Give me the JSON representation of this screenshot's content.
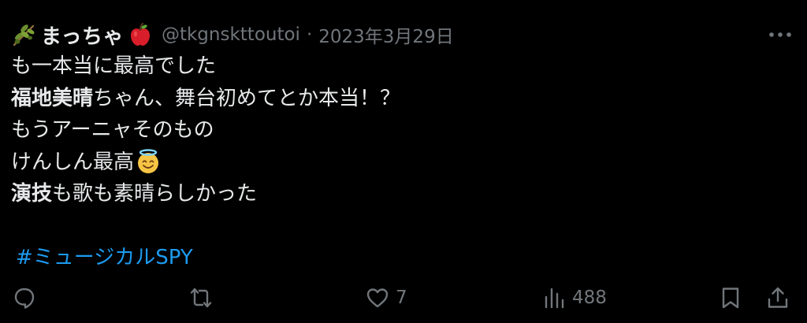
{
  "author": {
    "display_name": "まっちゃ",
    "handle": "@tkgnskttoutoi",
    "separator": "·",
    "date": "2023年3月29日"
  },
  "tweet": {
    "line1": "も一本当に最高でした",
    "line2_bold": "福地美晴",
    "line2_rest": "ちゃん、舞台初めてとか本当！？",
    "line3": "もうアーニャそのもの",
    "line4": "けんしん最高",
    "line5_bold": "演技",
    "line5_rest": "も歌も素晴らしかった",
    "hashtag": "#ミュージカルSPY"
  },
  "actions": {
    "likes": "7",
    "views": "488"
  },
  "icons": {
    "more": "more-dots-icon",
    "reply": "reply-icon",
    "retweet": "retweet-icon",
    "like": "heart-icon",
    "views": "analytics-icon",
    "bookmark": "bookmark-icon",
    "share": "share-icon"
  },
  "colors": {
    "background": "#000000",
    "text": "#e7e9ea",
    "secondary": "#71767b",
    "link": "#1d9bf0"
  }
}
